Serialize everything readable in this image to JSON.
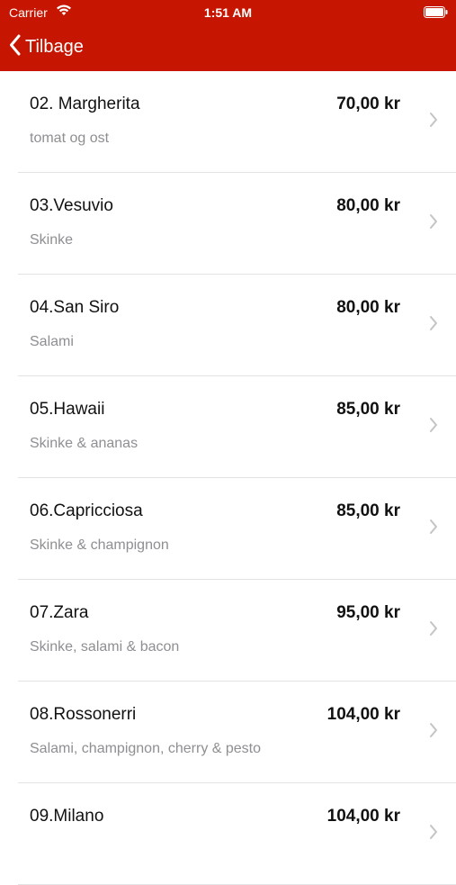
{
  "status_bar": {
    "carrier": "Carrier",
    "time": "1:51 AM"
  },
  "nav": {
    "back_label": "Tilbage"
  },
  "colors": {
    "nav_background": "#c61500",
    "secondary_text": "#8e8e93",
    "separator": "#e3e3e6"
  },
  "icons": {
    "wifi": "wifi-icon",
    "battery": "battery-icon",
    "back": "chevron-left-icon",
    "disclosure": "chevron-right-icon"
  },
  "menu_items": [
    {
      "name": "02. Margherita",
      "desc": "tomat og ost",
      "price": "70,00 kr"
    },
    {
      "name": "03.Vesuvio",
      "desc": "Skinke",
      "price": "80,00 kr"
    },
    {
      "name": "04.San Siro",
      "desc": "Salami",
      "price": "80,00 kr"
    },
    {
      "name": "05.Hawaii",
      "desc": "Skinke & ananas",
      "price": "85,00 kr"
    },
    {
      "name": "06.Capricciosa",
      "desc": "Skinke & champignon",
      "price": "85,00 kr"
    },
    {
      "name": "07.Zara",
      "desc": "Skinke, salami & bacon",
      "price": "95,00 kr"
    },
    {
      "name": "08.Rossonerri",
      "desc": "Salami, champignon, cherry & pesto",
      "price": "104,00 kr"
    },
    {
      "name": "09.Milano",
      "desc": "",
      "price": "104,00 kr"
    }
  ]
}
